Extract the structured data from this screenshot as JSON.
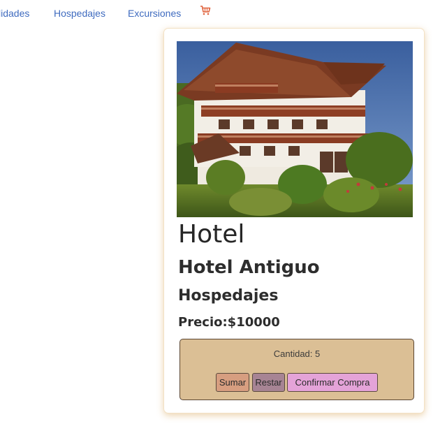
{
  "nav": {
    "items": [
      {
        "label": "lidades"
      },
      {
        "label": "Hospedajes"
      },
      {
        "label": "Excursiones"
      }
    ],
    "cart_icon": "shopping-cart-icon"
  },
  "card": {
    "image_alt": "hotel building photo",
    "title": "Hotel",
    "subtitle": "Hotel Antiguo",
    "category": "Hospedajes",
    "price": "Precio:$10000",
    "counter": {
      "quantity_text": "Cantidad: 5",
      "quantity": 5,
      "sumar_label": "Sumar",
      "restar_label": "Restar",
      "confirm_label": "Confirmar Compra"
    }
  },
  "colors": {
    "nav_link": "#3f6bbf",
    "cart": "#e0633d",
    "counter_bg": "#dbbf95",
    "sumar_bg": "#d79e80",
    "restar_bg": "#a78494",
    "confirm_bg": "#e4a3d8"
  }
}
